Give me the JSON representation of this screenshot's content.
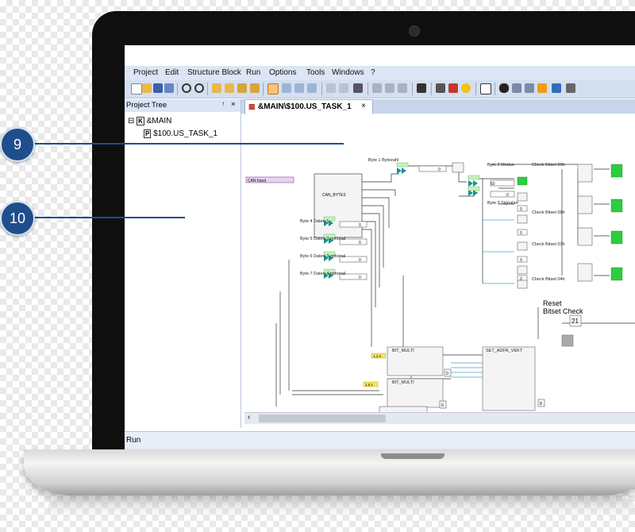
{
  "menu": {
    "items": [
      "Project",
      "Edit",
      "Structure Block",
      "Run",
      "Options",
      "Tools",
      "Windows",
      "?"
    ]
  },
  "toolbar": {
    "icons": [
      "new-icon",
      "open-icon",
      "save-icon",
      "save-all-icon",
      "zoom-in-icon",
      "zoom-out-icon",
      "folder-icon",
      "folder-open-icon",
      "folder-up-icon",
      "folder-down-icon",
      "select-icon",
      "copy-block-icon",
      "link-icon",
      "delete-icon",
      "undo-icon",
      "redo-icon",
      "print-icon",
      "cut-icon",
      "copy-icon",
      "paste-icon",
      "home-icon",
      "compile-icon",
      "download-icon",
      "idea-icon",
      "monitor-icon",
      "binoculars-icon",
      "table-icon",
      "refresh-icon",
      "edit-icon",
      "key-icon",
      "settings-icon"
    ]
  },
  "project_tree": {
    "title": "Project Tree",
    "pin": "↑",
    "close": "×",
    "root": {
      "badge": "K",
      "label": "&MAIN",
      "expand": "⊟"
    },
    "child": {
      "badge": "P",
      "label": "$100.US_TASK_1"
    }
  },
  "editor": {
    "tab_label": "&MAIN\\$100.US_TASK_1",
    "tab_close": "×",
    "diagram": {
      "input_label": "CAN Input",
      "main_block": "CAN_BYTES",
      "labels": [
        "Byte 1 Bytezahl",
        "Byte 2 Modus",
        "Byte 3 Signalart",
        "Byte 4 Daten 1",
        "Byte 5 Daten 2 optional",
        "Byte 6 Daten 3 optional",
        "Byte 7 Daten 4 optional",
        "Check Bitset 00h",
        "Check Bitset 08h",
        "Check Bitset 03h",
        "Check Bitset 04h"
      ],
      "reset_label": "Reset",
      "bitset_label": "Bitset Check",
      "blocks_lower": [
        "BIT_MULTI",
        "BIT_MULTI",
        "SET_ADFR_VEKT"
      ],
      "const_values": [
        "60",
        "0",
        "0",
        "0",
        "0",
        "0",
        "0",
        "0",
        "0",
        "0",
        "0",
        "0",
        "0",
        "21",
        "8"
      ],
      "consts_yellow": [
        "1,1,0",
        "1,0,1"
      ]
    }
  },
  "status": {
    "text": "Run"
  },
  "callouts": [
    "9",
    "10"
  ],
  "colors": {
    "callout": "#1e4e8c",
    "accent_green": "#2ecc40",
    "block_green": "#7fd9c0"
  }
}
